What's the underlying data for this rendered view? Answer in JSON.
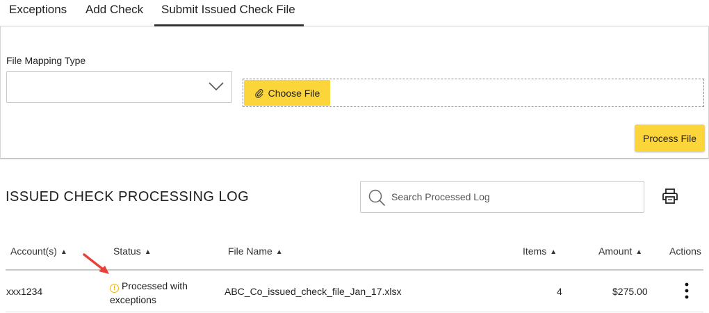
{
  "tabs": [
    {
      "label": "Exceptions"
    },
    {
      "label": "Add Check"
    },
    {
      "label": "Submit Issued Check File"
    }
  ],
  "upload": {
    "mapping_label": "File Mapping Type",
    "mapping_value": "",
    "choose_file_label": "Choose File",
    "process_file_label": "Process File"
  },
  "log": {
    "title": "ISSUED CHECK PROCESSING LOG",
    "search_placeholder": "Search Processed Log",
    "columns": [
      {
        "label": "Account(s)",
        "sortable": true
      },
      {
        "label": "Status",
        "sortable": true
      },
      {
        "label": "File Name",
        "sortable": true
      },
      {
        "label": "Items",
        "sortable": true
      },
      {
        "label": "Amount",
        "sortable": true
      },
      {
        "label": "Actions",
        "sortable": false
      }
    ],
    "rows": [
      {
        "account": "xxx1234",
        "status": "Processed with exceptions",
        "status_icon": "warning-circle-icon",
        "file_name": "ABC_Co_issued_check_file_Jan_17.xlsx",
        "items": "4",
        "amount": "$275.00"
      }
    ]
  },
  "sort_caret": "▲",
  "colors": {
    "accent_yellow": "#fcd53a",
    "warning": "#e8b21a",
    "annotation_arrow": "#e8413a"
  }
}
